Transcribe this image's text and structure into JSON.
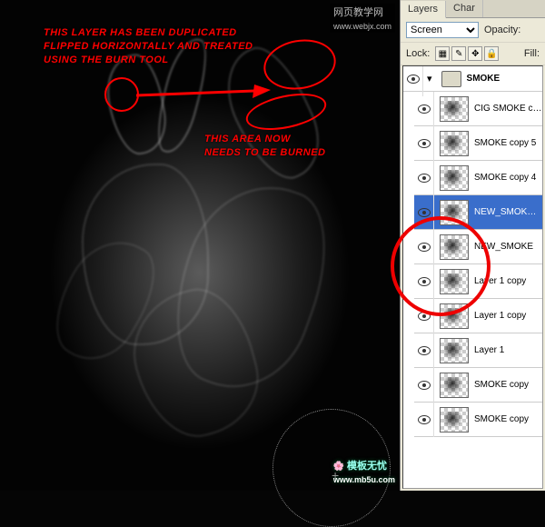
{
  "watermarks": {
    "top_right": "网页教学网",
    "top_right2": "www.webjx.com",
    "bottom_right": "模板无忧",
    "bottom_right2": "www.mb5u.com"
  },
  "annotations": {
    "a1_line1": "THIS LAYER HAS BEEN DUPLICATED",
    "a1_line2": "FLIPPED HORIZONTALLY AND TREATED",
    "a1_line3": "USING THE BURN TOOL",
    "a2_line1": "THIS AREA NOW",
    "a2_line2": "NEEDS TO BE BURNED"
  },
  "panel": {
    "tabs": [
      "Layers",
      "Char"
    ],
    "blend_label": "",
    "blend_value": "Screen",
    "opacity_label": "Opacity:",
    "lock_label": "Lock:",
    "fill_label": "Fill:",
    "group": "SMOKE",
    "layers": [
      {
        "name": "CIG SMOKE copy"
      },
      {
        "name": "SMOKE copy 5"
      },
      {
        "name": "SMOKE copy 4"
      },
      {
        "name": "NEW_SMOKE copy",
        "selected": true
      },
      {
        "name": "NEW_SMOKE"
      },
      {
        "name": "Layer 1 copy"
      },
      {
        "name": "Layer 1 copy"
      },
      {
        "name": "Layer 1"
      },
      {
        "name": "SMOKE copy"
      },
      {
        "name": "SMOKE copy"
      }
    ]
  }
}
